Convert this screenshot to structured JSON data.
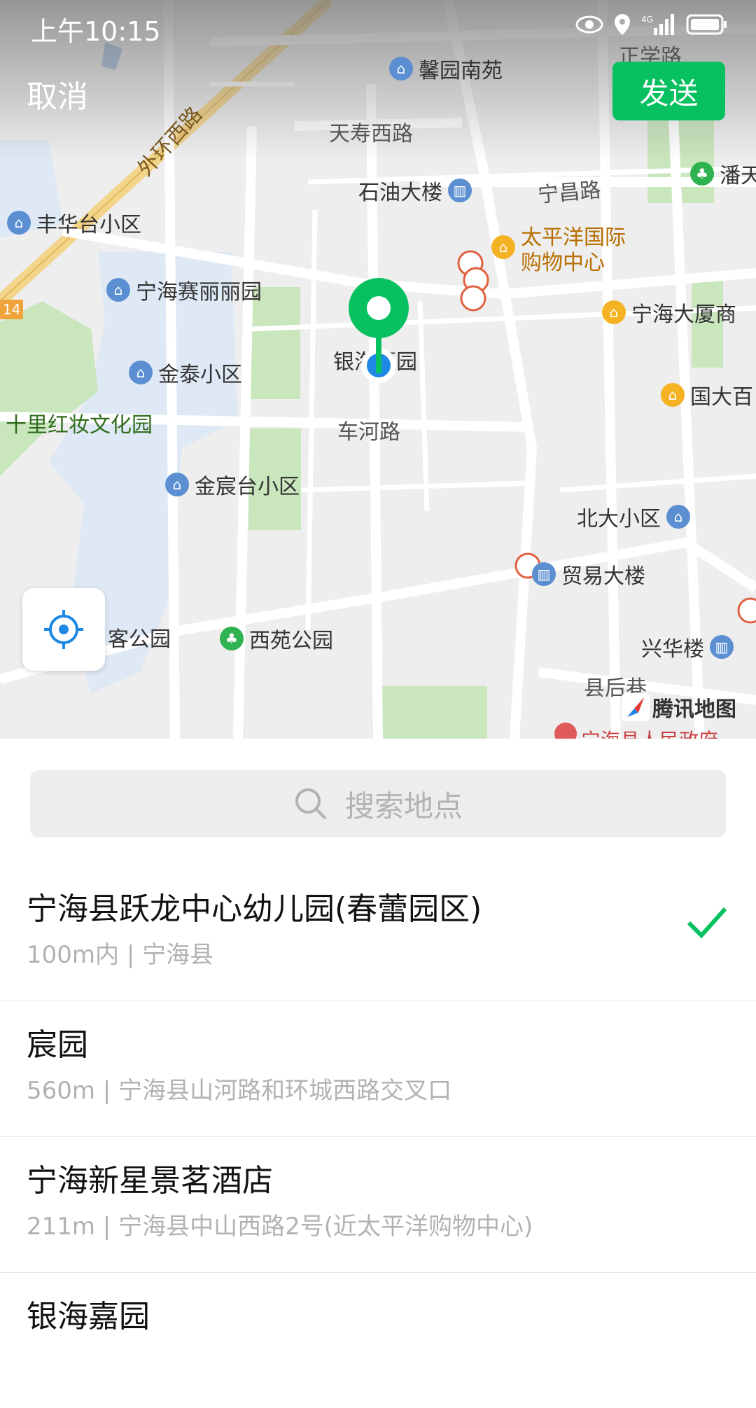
{
  "status_bar": {
    "time": "上午10:15"
  },
  "header": {
    "cancel_label": "取消",
    "send_label": "发送"
  },
  "map": {
    "pois": [
      {
        "label": "馨园南苑",
        "icon": "residence-icon",
        "color": "blue"
      },
      {
        "label": "石油大楼",
        "icon": "building-icon",
        "color": "blue"
      },
      {
        "label": "丰华台小区",
        "icon": "residence-icon",
        "color": "blue"
      },
      {
        "label": "宁海赛丽丽园",
        "icon": "residence-icon",
        "color": "blue"
      },
      {
        "label": "金泰小区",
        "icon": "residence-icon",
        "color": "blue"
      },
      {
        "label": "金宸台小区",
        "icon": "residence-icon",
        "color": "blue"
      },
      {
        "label": "北大小区",
        "icon": "residence-icon",
        "color": "blue"
      },
      {
        "label": "贸易大楼",
        "icon": "building-icon",
        "color": "blue"
      },
      {
        "label": "兴华楼",
        "icon": "building-icon",
        "color": "blue"
      },
      {
        "label": "宁海大厦商",
        "icon": "shop-icon",
        "color": "orange"
      },
      {
        "label": "国大百",
        "icon": "shop-icon",
        "color": "orange"
      },
      {
        "label": "西苑公园",
        "icon": "park-icon",
        "color": "green"
      },
      {
        "label": "潘天",
        "icon": "park-icon",
        "color": "green"
      },
      {
        "label": "客公园",
        "icon": "park-icon",
        "color": "green"
      }
    ],
    "mall_label_1": "太平洋国际",
    "mall_label_2": "购物中心",
    "roads": [
      "天寿西路",
      "宁昌路",
      "车河路",
      "县后巷",
      "正学路",
      "外环西路",
      "十里红妆文化园",
      "银海嘉园"
    ],
    "highway_shield": "14",
    "brand": "腾讯地图",
    "gov_label": "宁海县人民政府"
  },
  "search": {
    "placeholder": "搜索地点"
  },
  "results": [
    {
      "name": "宁海县跃龙中心幼儿园(春蕾园区)",
      "sub": "100m内 | 宁海县",
      "selected": true
    },
    {
      "name": "宸园",
      "sub": "560m | 宁海县山河路和环城西路交叉口",
      "selected": false
    },
    {
      "name": "宁海新星景茗酒店",
      "sub": "211m | 宁海县中山西路2号(近太平洋购物中心)",
      "selected": false
    },
    {
      "name": "银海嘉园",
      "sub": "",
      "selected": false
    }
  ],
  "colors": {
    "accent": "#07c160",
    "location_blue": "#1e88e5"
  }
}
